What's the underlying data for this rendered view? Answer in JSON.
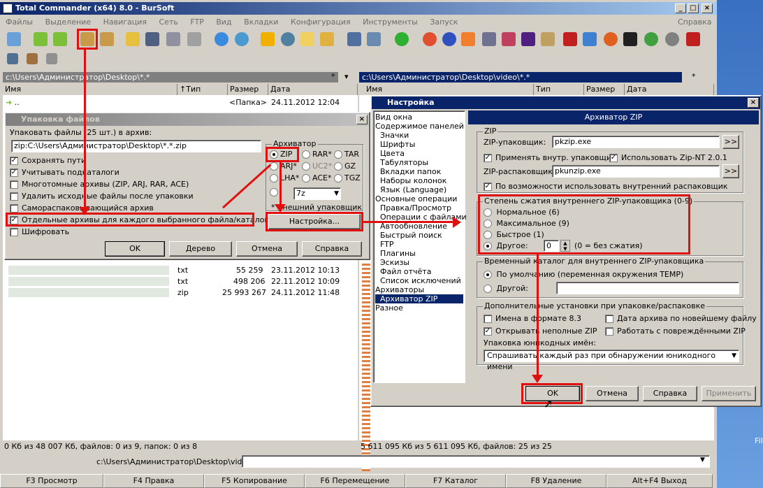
{
  "app": {
    "title": "Total Commander (x64) 8.0 - BurSoft",
    "help": "Справка"
  },
  "menu": [
    "Файлы",
    "Выделение",
    "Навигация",
    "Сеть",
    "FTP",
    "Вид",
    "Вкладки",
    "Конфигурация",
    "Инструменты",
    "Запуск"
  ],
  "left_panel": {
    "path": "c:\\Users\\Администратор\\Desktop\\*.*",
    "star": "*",
    "cols": {
      "name": "Имя",
      "type": "Тип",
      "size": "Размер",
      "date": "Дата"
    },
    "up_row": {
      "name": "..",
      "size": "<Папка>",
      "date": "24.11.2012 12:04"
    },
    "files": [
      {
        "ext": "txt",
        "size": "55 259",
        "date": "23.11.2012 10:13"
      },
      {
        "ext": "txt",
        "size": "498 206",
        "date": "22.11.2012 10:09"
      },
      {
        "ext": "zip",
        "size": "25 993 267",
        "date": "24.11.2012 11:48"
      }
    ],
    "status": "0 Кб из 48 007 Кб, файлов: 0 из 9, папок: 0 из 8"
  },
  "right_panel": {
    "path": "c:\\Users\\Администратор\\Desktop\\video\\*.*",
    "star": "*",
    "cols": {
      "name": "Имя",
      "type": "Тип",
      "size": "Размер",
      "date": "Дата"
    },
    "status": "5 611 095 Кб из 5 611 095 Кб, файлов: 25 из 25"
  },
  "cmdline": {
    "path": "c:\\Users\\Администратор\\Desktop\\video>"
  },
  "fkeys": [
    "F3 Просмотр",
    "F4 Правка",
    "F5 Копирование",
    "F6 Перемещение",
    "F7 Каталог",
    "F8 Удаление",
    "Alt+F4 Выход"
  ],
  "pack_dialog": {
    "title": "Упаковка файлов",
    "prompt": "Упаковать файлы (25 шт.) в архив:",
    "target": "zip:C:\\Users\\Администратор\\Desktop\\*.*.zip",
    "options": [
      {
        "label": "Сохранять пути",
        "checked": true
      },
      {
        "label": "Учитывать подкаталоги",
        "checked": true
      },
      {
        "label": "Многотомные архивы (ZIP, ARJ, RAR, ACE)",
        "checked": false
      },
      {
        "label": "Удалить исходные файлы после упаковки",
        "checked": false
      },
      {
        "label": "Самораспаковывающийся архив",
        "checked": false
      },
      {
        "label": "Отдельные архивы для каждого выбранного файла/каталога",
        "checked": true
      },
      {
        "label": "Шифровать",
        "checked": false
      }
    ],
    "archiver_group": "Архиватор",
    "archivers": [
      "ZIP",
      "RAR*",
      "TAR",
      "ARJ*",
      "UC2*",
      "GZ",
      "LHA*",
      "ACE*",
      "TGZ"
    ],
    "sevenzip": "7z",
    "external_note": "* Внешний упаковщик",
    "settings_btn": "Настройка...",
    "buttons": [
      "OK",
      "Дерево",
      "Отмена",
      "Справка"
    ]
  },
  "settings_dialog": {
    "title": "Настройка",
    "tree": [
      "Вид окна",
      "Содержимое панелей",
      "Значки",
      "Шрифты",
      "Цвета",
      "Табуляторы",
      "Вкладки папок",
      "Наборы колонок",
      "Язык (Language)",
      "Основные операции",
      "Правка/Просмотр",
      "Операции с файлами",
      "Автообновление",
      "Быстрый поиск",
      "FTP",
      "Плагины",
      "Эскизы",
      "Файл отчёта",
      "Список исключений",
      "Архиваторы",
      "Архиватор ZIP",
      "Разное"
    ],
    "page_title": "Архиватор ZIP",
    "zip_group": "ZIP",
    "packer_label": "ZIP-упаковщик:",
    "packer_value": "pkzip.exe",
    "use_internal_packer": "Применять внутр. упаковщик",
    "use_zipnt": "Использовать Zip-NT 2.0.1",
    "unpacker_label": "ZIP-распаковщик:",
    "unpacker_value": "pkunzip.exe",
    "use_internal_unpacker": "По возможности использовать внутренний распаковщик",
    "browse": ">>",
    "compression_group": "Степень сжатия внутреннего ZIP-упаковщика (0-9)",
    "compression": [
      {
        "label": "Нормальное (6)",
        "selected": false
      },
      {
        "label": "Максимальное (9)",
        "selected": false
      },
      {
        "label": "Быстрое (1)",
        "selected": false
      },
      {
        "label": "Другое:",
        "selected": true
      }
    ],
    "other_value": "0",
    "other_note": "(0 = без сжатия)",
    "temp_group": "Временный каталог для внутреннего ZIP-упаковщика",
    "temp_default": "По умолчанию (переменная окружения TEMP)",
    "temp_other": "Другой:",
    "extra_group": "Дополнительные установки при упаковке/распаковке",
    "names83": "Имена в формате 8.3",
    "archive_date": "Дата архива по новейшему файлу",
    "open_incomplete": "Открывать неполные ZIP",
    "work_damaged": "Работать с повреждёнными ZIP",
    "unicode_label": "Упаковка юникодных имён:",
    "unicode_value": "Спрашивать каждый раз при обнаружении юникодного имени",
    "buttons": [
      "OK",
      "Отмена",
      "Справка",
      "Применить"
    ]
  },
  "desktop_label": "Fil"
}
